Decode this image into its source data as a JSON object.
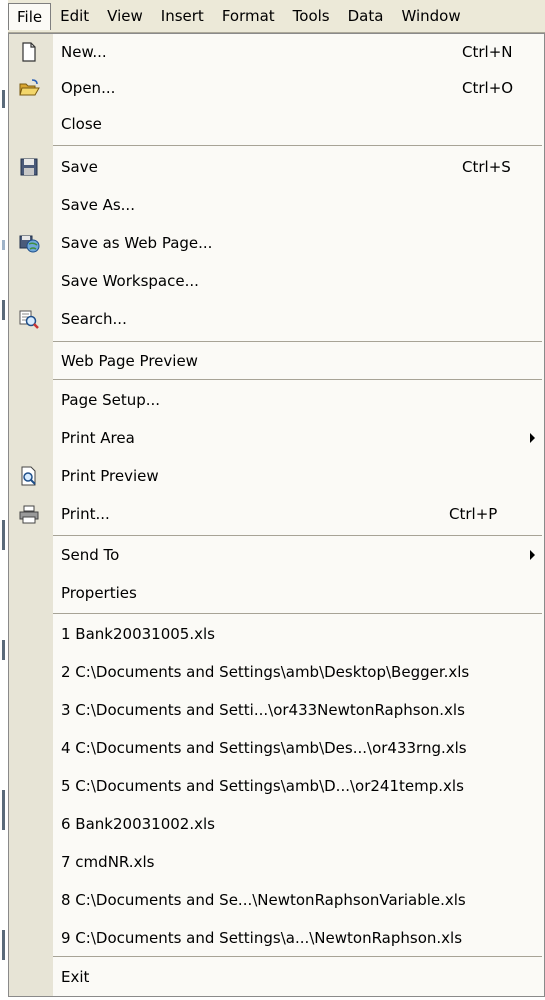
{
  "menubar": {
    "items": [
      {
        "label": "File"
      },
      {
        "label": "Edit"
      },
      {
        "label": "View"
      },
      {
        "label": "Insert"
      },
      {
        "label": "Format"
      },
      {
        "label": "Tools"
      },
      {
        "label": "Data"
      },
      {
        "label": "Window"
      }
    ]
  },
  "file_menu": {
    "items": [
      {
        "label": "New...",
        "shortcut": "Ctrl+N",
        "icon": "new-document-icon"
      },
      {
        "label": "Open...",
        "shortcut": "Ctrl+O",
        "icon": "open-folder-icon"
      },
      {
        "label": "Close"
      },
      {
        "label": "Save",
        "shortcut": "Ctrl+S",
        "icon": "save-disk-icon"
      },
      {
        "label": "Save As..."
      },
      {
        "label": "Save as Web Page...",
        "icon": "save-web-page-icon"
      },
      {
        "label": "Save Workspace..."
      },
      {
        "label": "Search...",
        "icon": "search-icon"
      },
      {
        "label": "Web Page Preview"
      },
      {
        "label": "Page Setup..."
      },
      {
        "label": "Print Area",
        "submenu": true
      },
      {
        "label": "Print Preview",
        "icon": "print-preview-icon"
      },
      {
        "label": "Print...",
        "shortcut": "Ctrl+P",
        "icon": "printer-icon"
      },
      {
        "label": "Send To",
        "submenu": true
      },
      {
        "label": "Properties"
      },
      {
        "label": "1 Bank20031005.xls"
      },
      {
        "label": "2 C:\\Documents and Settings\\amb\\Desktop\\Begger.xls"
      },
      {
        "label": "3 C:\\Documents and Setti...\\or433NewtonRaphson.xls"
      },
      {
        "label": "4 C:\\Documents and Settings\\amb\\Des...\\or433rng.xls"
      },
      {
        "label": "5 C:\\Documents and Settings\\amb\\D...\\or241temp.xls"
      },
      {
        "label": "6 Bank20031002.xls"
      },
      {
        "label": "7 cmdNR.xls"
      },
      {
        "label": "8 C:\\Documents and Se...\\NewtonRaphsonVariable.xls"
      },
      {
        "label": "9 C:\\Documents and Settings\\a...\\NewtonRaphson.xls"
      },
      {
        "label": "Exit"
      }
    ]
  }
}
